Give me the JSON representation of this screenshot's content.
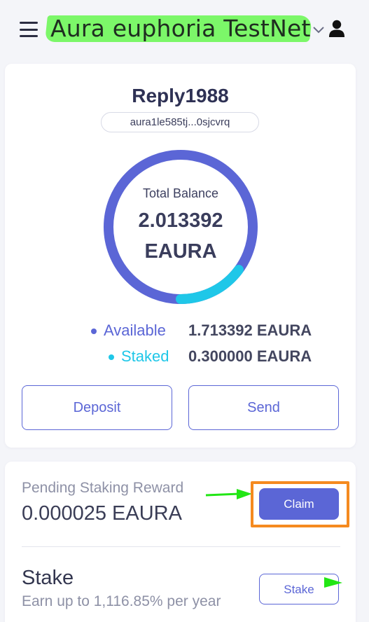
{
  "header": {
    "network_name": "Aura euphoria TestNet",
    "icons": {
      "menu": "hamburger-menu-icon",
      "dropdown": "chevron-down-icon",
      "account": "user-icon"
    }
  },
  "wallet": {
    "account_name": "Reply1988",
    "address": "aura1le585tj...0sjcvrq",
    "total_balance_label": "Total Balance",
    "total_balance_value": "2.013392",
    "total_balance_unit": "EAURA",
    "breakdown": [
      {
        "label": "Available",
        "value": "1.713392 EAURA",
        "amount": 1.713392,
        "color": "#5b66d6"
      },
      {
        "label": "Staked",
        "value": "0.300000 EAURA",
        "amount": 0.3,
        "color": "#1fc7e8"
      }
    ],
    "deposit_label": "Deposit",
    "send_label": "Send"
  },
  "staking": {
    "pending_label": "Pending Staking Reward",
    "pending_value": "0.000025 EAURA",
    "claim_label": "Claim",
    "stake_title": "Stake",
    "stake_subtitle": "Earn up to 1,116.85% per year",
    "stake_label": "Stake"
  },
  "colors": {
    "accent": "#5b66d6",
    "staked": "#1fc7e8",
    "highlight_green": "#7cf769",
    "annotation_orange": "#f58a1f",
    "annotation_arrow": "#22e615"
  }
}
